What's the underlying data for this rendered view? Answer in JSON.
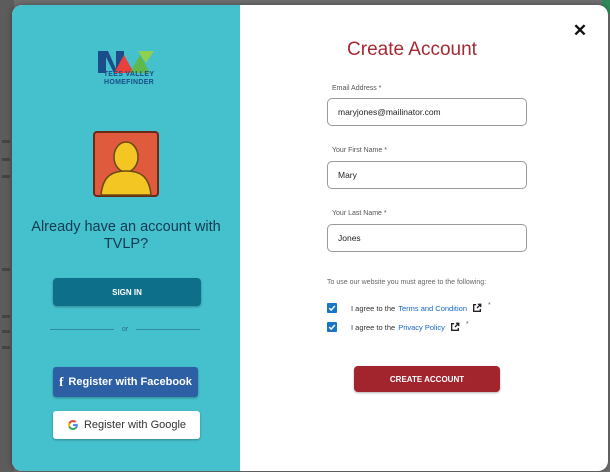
{
  "left": {
    "logo_line1": "TEES VALLEY",
    "logo_line2": "HOMEFINDER",
    "title": "Already have an account with TVLP?",
    "signin_label": "SIGN IN",
    "or_label": "or",
    "facebook_icon": "f",
    "facebook_label": "Register with Facebook",
    "google_label": "Register with Google"
  },
  "form": {
    "close_glyph": "✕",
    "title": "Create Account",
    "email_label": "Email Address *",
    "email_value": "maryjones@mailinator.com",
    "first_name_label": "Your First Name *",
    "first_name_value": "Mary",
    "last_name_label": "Your Last Name *",
    "last_name_value": "Jones",
    "agree_intro": "To use our website you must agree to the following:",
    "terms_prefix": "I agree to the",
    "terms_link": "Terms and Condition",
    "privacy_prefix": "I agree to the",
    "privacy_link": "Privacy Policy",
    "required_mark": "*",
    "create_label": "CREATE ACCOUNT"
  },
  "colors": {
    "panel": "#45c0cd",
    "signin": "#0e6f8a",
    "facebook": "#2d5fa5",
    "accent": "#a52a33",
    "checkbox": "#1976c6",
    "link": "#1565c0"
  },
  "icons": [
    "tees-valley-logo",
    "user-avatar-icon",
    "facebook-icon",
    "google-icon",
    "close-icon",
    "checkmark-icon",
    "external-link-icon"
  ]
}
